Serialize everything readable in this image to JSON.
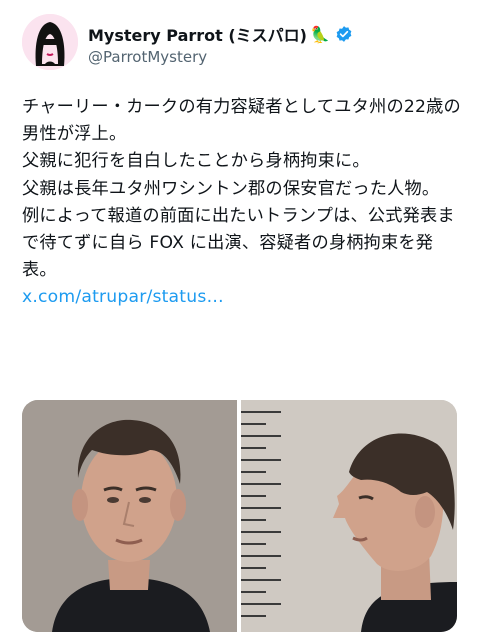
{
  "account": {
    "display_name": "Mystery Parrot (ミスパロ)",
    "name_emoji": "🦜",
    "handle": "@ParrotMystery",
    "verified": true,
    "verified_color": "#1d9bf0"
  },
  "tweet": {
    "paragraphs": [
      "チャーリー・カークの有力容疑者としてユタ州の22歳の男性が浮上。",
      "父親に犯行を自白したことから身柄拘束に。",
      "父親は長年ユタ州ワシントン郡の保安官だった人物。",
      "例によって報道の前面に出たいトランプは、公式発表まで待てずに自ら FOX に出演、容疑者の身柄拘束を発表。"
    ],
    "link_text": "x.com/atrupar/status…"
  },
  "media": {
    "images": [
      {
        "description_icon": "mugshot-front"
      },
      {
        "description_icon": "mugshot-profile"
      }
    ]
  },
  "colors": {
    "text": "#0f1419",
    "secondary": "#536471",
    "link": "#1d9bf0"
  }
}
